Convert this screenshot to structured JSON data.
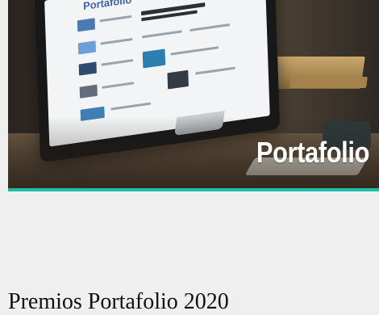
{
  "hero": {
    "brand_text": "Portafolio",
    "screen_logo": "Portafolio",
    "accent_color": "#1fbfa6"
  },
  "article": {
    "title": "Premios Portafolio 2020"
  }
}
